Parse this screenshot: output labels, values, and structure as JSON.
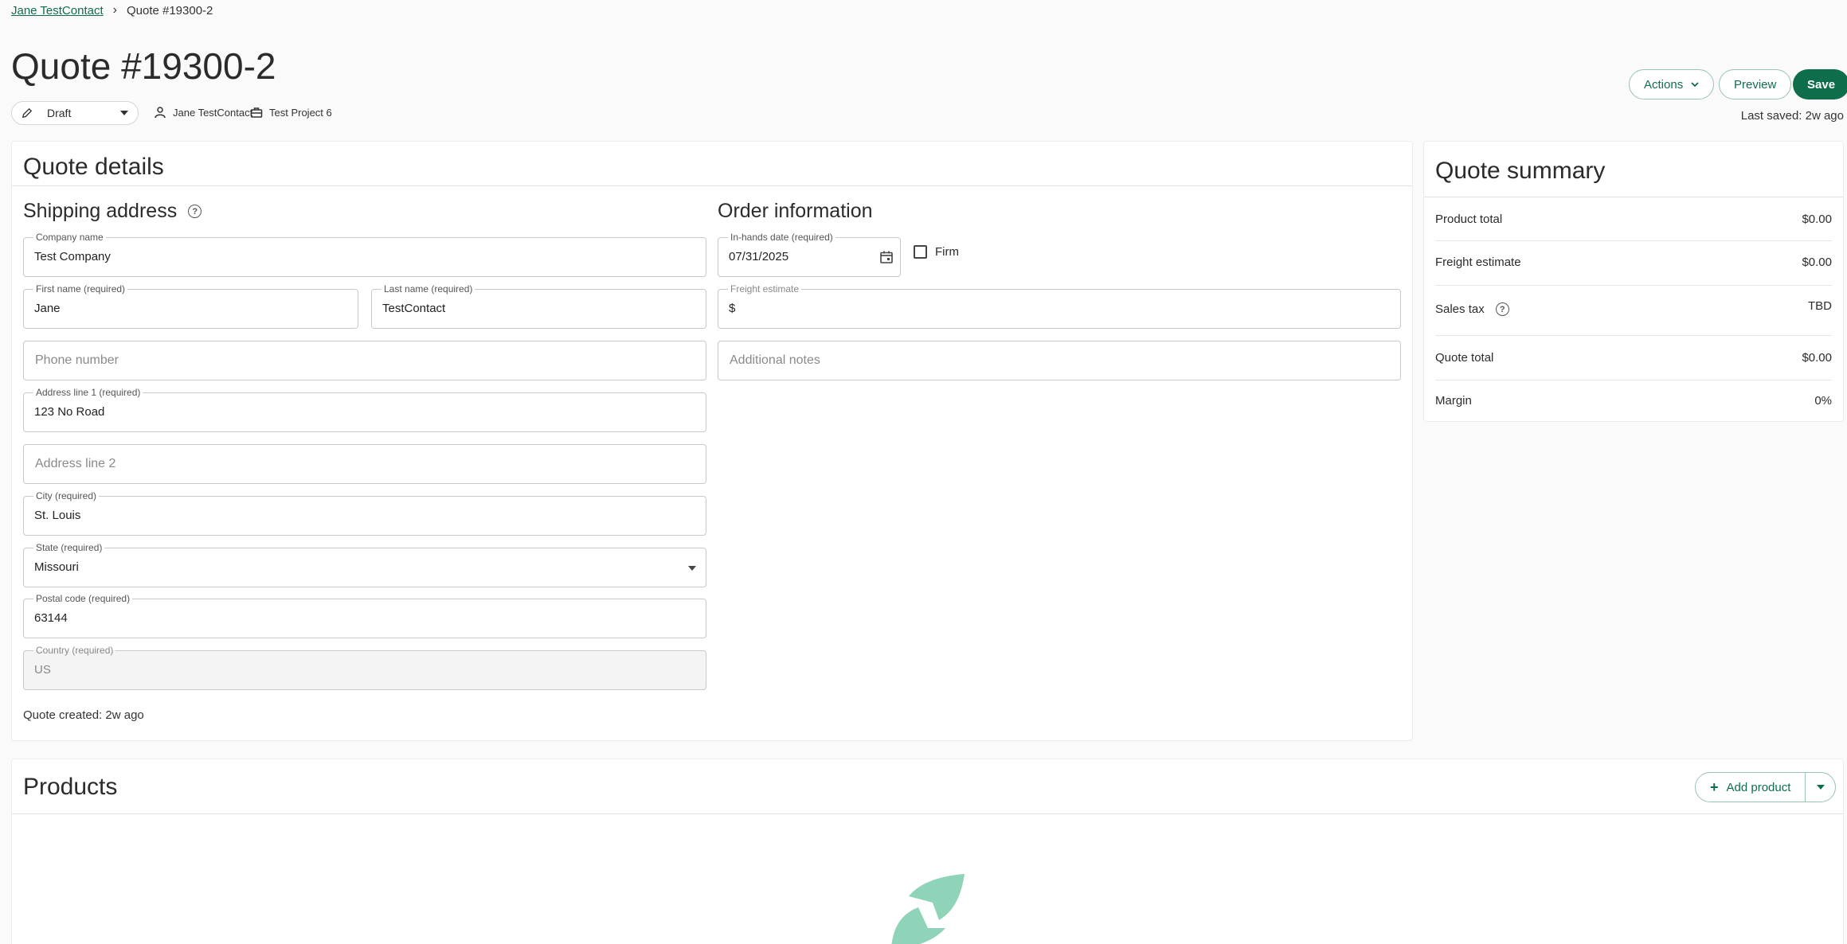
{
  "breadcrumb": {
    "parent": "Jane TestContact",
    "separator": "›",
    "current": "Quote #19300-2"
  },
  "page_title": "Quote #19300-2",
  "status": {
    "selected": "Draft"
  },
  "meta": {
    "contact": "Jane TestContact",
    "project": "Test Project 6"
  },
  "toolbar": {
    "actions_label": "Actions",
    "preview_label": "Preview",
    "save_label": "Save",
    "last_saved": "Last saved: 2w ago"
  },
  "quote_details": {
    "title": "Quote details",
    "shipping": {
      "title": "Shipping address",
      "company": {
        "label": "Company name",
        "value": "Test Company"
      },
      "first_name": {
        "label": "First name (required)",
        "value": "Jane"
      },
      "last_name": {
        "label": "Last name (required)",
        "value": "TestContact"
      },
      "phone": {
        "placeholder": "Phone number"
      },
      "address1": {
        "label": "Address line 1 (required)",
        "value": "123 No Road"
      },
      "address2": {
        "placeholder": "Address line 2"
      },
      "city": {
        "label": "City (required)",
        "value": "St. Louis"
      },
      "state": {
        "label": "State (required)",
        "value": "Missouri"
      },
      "postal": {
        "label": "Postal code (required)",
        "value": "63144"
      },
      "country": {
        "label": "Country (required)",
        "value": "US"
      }
    },
    "order": {
      "title": "Order information",
      "in_hands": {
        "label": "In-hands date (required)",
        "value": "07/31/2025"
      },
      "firm_label": "Firm",
      "freight": {
        "label": "Freight estimate",
        "value": "$"
      },
      "notes": {
        "placeholder": "Additional notes"
      }
    },
    "created": "Quote created: 2w ago"
  },
  "summary": {
    "title": "Quote summary",
    "rows": [
      {
        "label": "Product total",
        "value": "$0.00"
      },
      {
        "label": "Freight estimate",
        "value": "$0.00"
      },
      {
        "label": "Sales tax",
        "value": "TBD"
      },
      {
        "label": "Quote total",
        "value": "$0.00"
      },
      {
        "label": "Margin",
        "value": "0%"
      }
    ]
  },
  "products": {
    "title": "Products",
    "add_label": "Add product"
  },
  "colors": {
    "brand": "#0f6e4a",
    "logo": "#8fd4b8"
  }
}
